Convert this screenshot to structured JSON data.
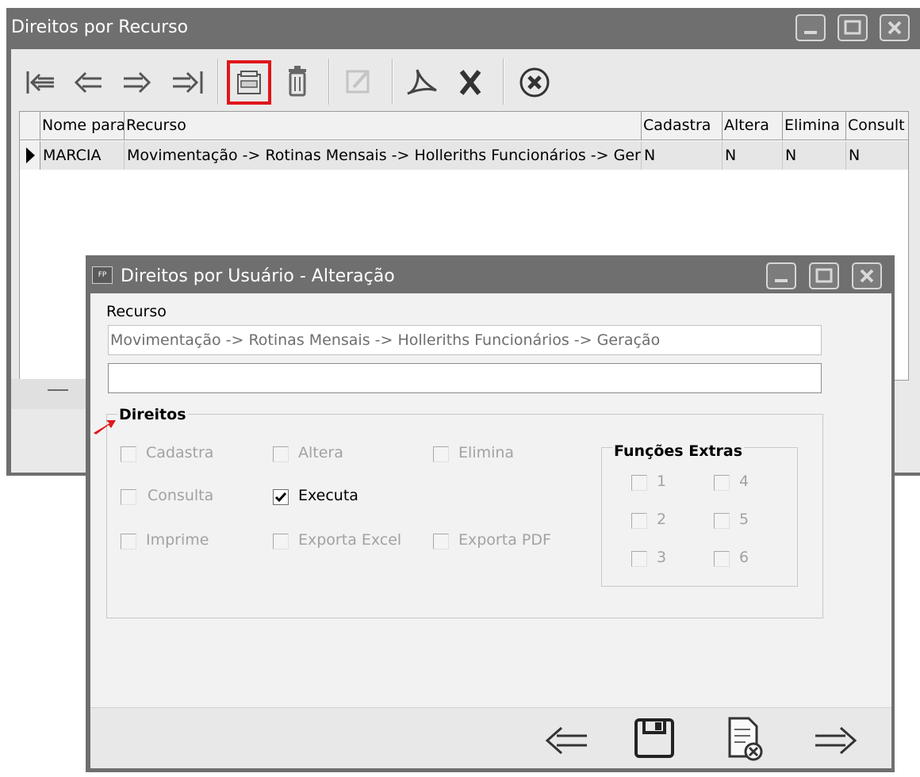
{
  "outer_window": {
    "title": "Direitos por Recurso",
    "controls": [
      "minimize-icon",
      "maximize-icon",
      "close-icon"
    ]
  },
  "toolbar": {
    "icons": [
      "first-record-icon",
      "previous-record-icon",
      "next-record-icon",
      "last-record-icon",
      "edit-record-icon",
      "trash-icon",
      "edit-disabled-icon",
      "pdf-export-icon",
      "excel-export-icon",
      "close-circle-icon"
    ],
    "highlight_color": "#e0161a"
  },
  "grid": {
    "columns": [
      "Nome para",
      "Recurso",
      "Cadastra",
      "Altera",
      "Elimina",
      "Consult"
    ],
    "rows": [
      {
        "nome": "MARCIA",
        "recurso": "Movimentação -> Rotinas Mensais -> Holleriths Funcionários -> Ger",
        "cadastra": "N",
        "altera": "N",
        "elimina": "N",
        "consulta": "N"
      }
    ]
  },
  "dialog": {
    "title": "Direitos por Usuário - Alteração",
    "icon_text": "FP",
    "recurso_label": "Recurso",
    "recurso_value": "Movimentação -> Rotinas Mensais -> Holleriths Funcionários -> Geração",
    "second_field_value": "",
    "direitos_label": "Direitos",
    "direitos": [
      {
        "label": "Cadastra",
        "checked": false
      },
      {
        "label": "Altera",
        "checked": false
      },
      {
        "label": "Elimina",
        "checked": false
      },
      {
        "label": "Consulta",
        "checked": false
      },
      {
        "label": "Executa",
        "checked": true
      },
      {
        "label": "Imprime",
        "checked": false
      },
      {
        "label": "Exporta Excel",
        "checked": false
      },
      {
        "label": "Exporta PDF",
        "checked": false
      }
    ],
    "funcoes_label": "Funções Extras",
    "funcoes": [
      {
        "label": "1",
        "checked": false
      },
      {
        "label": "4",
        "checked": false
      },
      {
        "label": "2",
        "checked": false
      },
      {
        "label": "5",
        "checked": false
      },
      {
        "label": "3",
        "checked": false
      },
      {
        "label": "6",
        "checked": false
      }
    ],
    "footer_icons": [
      "back-arrow-icon",
      "save-icon",
      "cancel-document-icon",
      "forward-arrow-icon"
    ]
  }
}
